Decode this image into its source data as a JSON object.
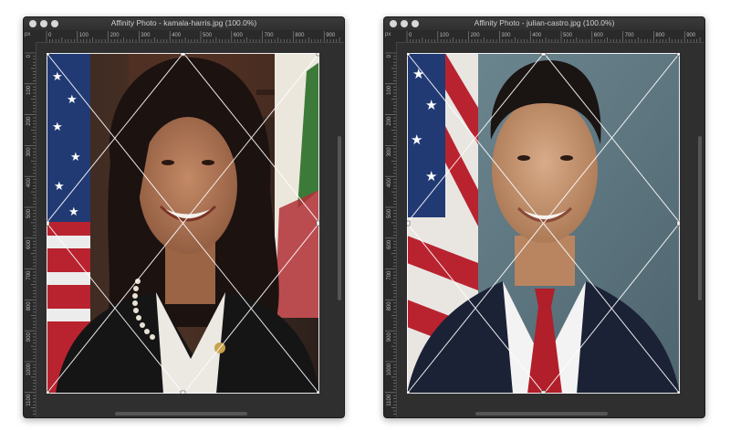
{
  "windows": [
    {
      "title": "Affinity Photo - kamala-harris.jpg (100.0%)",
      "ruler_unit": "px",
      "h_ticks": [
        "0",
        "100",
        "200",
        "300",
        "400",
        "500",
        "600",
        "700",
        "800",
        "900"
      ],
      "v_ticks": [
        "0",
        "100",
        "200",
        "300",
        "400",
        "500",
        "600",
        "700",
        "800",
        "900",
        "1000",
        "1100"
      ]
    },
    {
      "title": "Affinity Photo - julian-castro.jpg (100.0%)",
      "ruler_unit": "px",
      "h_ticks": [
        "0",
        "100",
        "200",
        "300",
        "400",
        "500",
        "600",
        "700",
        "800",
        "900"
      ],
      "v_ticks": [
        "0",
        "100",
        "200",
        "300",
        "400",
        "500",
        "600",
        "700",
        "800",
        "900",
        "1000",
        "1100"
      ]
    }
  ]
}
